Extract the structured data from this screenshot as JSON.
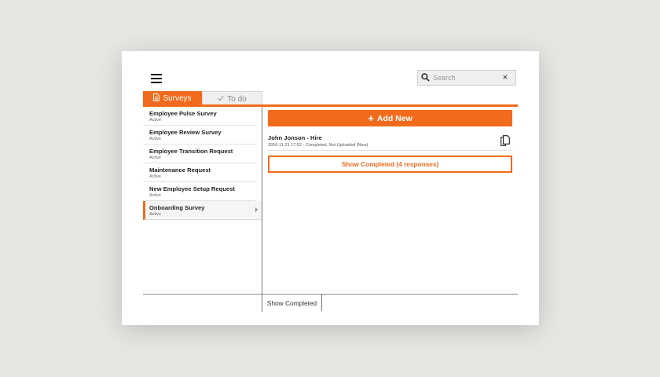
{
  "header": {
    "menu_icon": "hamburger-menu-icon",
    "search": {
      "placeholder": "Search",
      "value": "",
      "clear_label": "×",
      "icon": "search-icon"
    }
  },
  "tabs": [
    {
      "label": "Surveys",
      "icon": "document-icon",
      "active": true
    },
    {
      "label": "To do",
      "icon": "checkmark-icon",
      "active": false
    }
  ],
  "sidebar": {
    "items": [
      {
        "title": "Employee Pulse Survey",
        "status": "Active"
      },
      {
        "title": "Employee Review Survey",
        "status": "Active"
      },
      {
        "title": "Employee Transition Request",
        "status": "Active"
      },
      {
        "title": "Maintenance Request",
        "status": "Active"
      },
      {
        "title": "New Employee Setup Request",
        "status": "Active"
      },
      {
        "title": "Onboarding Survey",
        "status": "Active"
      }
    ]
  },
  "main": {
    "add_new": {
      "plus": "+",
      "label": "Add New"
    },
    "responses": [
      {
        "title": "John Jonson - Hire",
        "subtitle": "2016-11-21 17:52 - Completed, Not Uploaded (New)",
        "icon": "copy-icon"
      }
    ],
    "show_completed_button": "Show Completed (4 responses)"
  },
  "footer": {
    "show_completed_tab": "Show Completed"
  },
  "colors": {
    "accent": "#f26b1d",
    "background": "#e8e6e3",
    "card": "#ffffff"
  }
}
